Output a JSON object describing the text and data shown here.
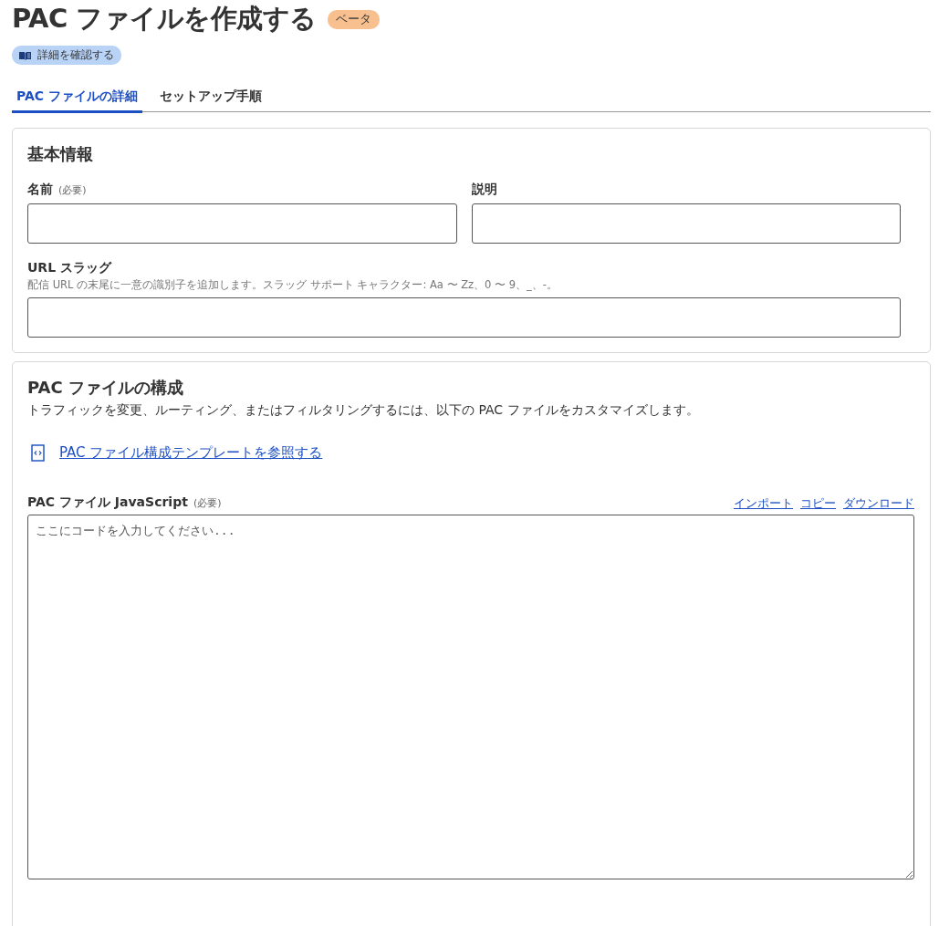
{
  "header": {
    "title": "PAC ファイルを作成する",
    "badge": "ベータ",
    "learn_more": "詳細を確認する"
  },
  "tabs": [
    {
      "label": "PAC ファイルの詳細",
      "selected": true
    },
    {
      "label": "セットアップ手順",
      "selected": false
    }
  ],
  "basic_info": {
    "title": "基本情報",
    "fields": [
      {
        "label": "名前",
        "required": "(必要)"
      },
      {
        "label": "説明"
      }
    ],
    "slug": {
      "label": "URL スラッグ",
      "hint": "配信 URL の末尾に一意の識別子を追加します。スラッグ サポート キャラクター: Aa 〜 Zz、0 〜 9、_、-。"
    }
  },
  "config": {
    "title": "PAC ファイルの構成",
    "description": "トラフィックを変更、ルーティング、またはフィルタリングするには、以下の PAC ファイルをカスタマイズします。",
    "template_link": "PAC ファイル構成テンプレートを参照する",
    "code_label": "PAC ファイル JavaScript",
    "code_required": "(必要)",
    "actions": [
      "インポート",
      "コピー",
      "ダウンロード"
    ],
    "code_placeholder": "ここにコードを入力してください..."
  }
}
